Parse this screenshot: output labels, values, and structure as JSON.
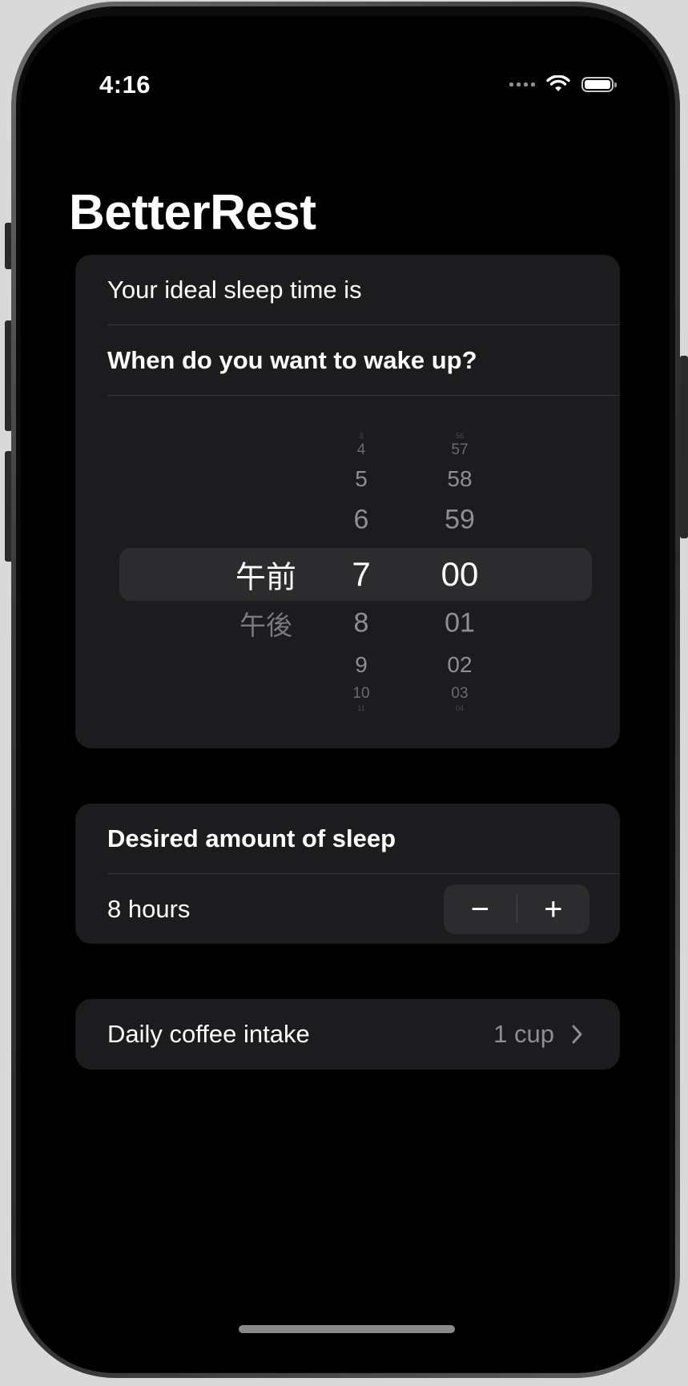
{
  "status_bar": {
    "time": "4:16"
  },
  "app_title": "BetterRest",
  "sleep_section": {
    "ideal_label": "Your ideal sleep time is",
    "wake_question": "When do you want to wake up?"
  },
  "time_picker": {
    "period_column": [
      "午前",
      "午後"
    ],
    "period_selected": "午前",
    "hour_column": [
      "3",
      "4",
      "5",
      "6",
      "7",
      "8",
      "9",
      "10",
      "11"
    ],
    "hour_selected": "7",
    "minute_column": [
      "56",
      "57",
      "58",
      "59",
      "00",
      "01",
      "02",
      "03",
      "04"
    ],
    "minute_selected": "00"
  },
  "sleep_amount": {
    "header": "Desired amount of sleep",
    "value": "8 hours",
    "decrement_symbol": "−",
    "increment_symbol": "+"
  },
  "coffee": {
    "label": "Daily coffee intake",
    "value": "1 cup",
    "chevron": "chevron-right-icon"
  },
  "colors": {
    "background": "#000000",
    "card": "#1c1c1e",
    "picker_highlight": "#2c2c2e",
    "secondary_text": "#8e8e93"
  }
}
